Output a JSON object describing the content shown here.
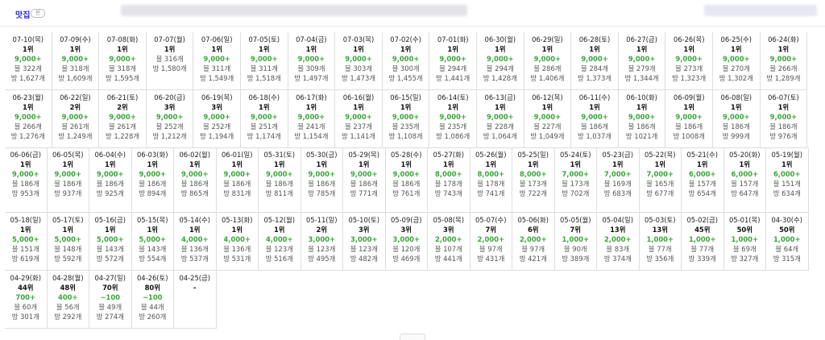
{
  "header": {
    "brand": "맛집",
    "brand_badge": "판"
  },
  "rows": [
    [
      {
        "date": "07-10(목)",
        "rank": "1위",
        "vol": "9,000+",
        "a": "블 322개",
        "b": "방 1,627개"
      },
      {
        "date": "07-09(수)",
        "rank": "1위",
        "vol": "9,000+",
        "a": "블 318개",
        "b": "방 1,609개"
      },
      {
        "date": "07-08(화)",
        "rank": "1위",
        "vol": "9,000+",
        "a": "블 318개",
        "b": "방 1,595개"
      },
      {
        "date": "07-07(월)",
        "rank": "1위",
        "vol": "",
        "a": "블 316개",
        "b": "방 1,580개"
      },
      {
        "date": "07-06(일)",
        "rank": "1위",
        "vol": "9,000+",
        "a": "블 311개",
        "b": "방 1,549개"
      },
      {
        "date": "07-05(토)",
        "rank": "1위",
        "vol": "9,000+",
        "a": "블 311개",
        "b": "방 1,518개"
      },
      {
        "date": "07-04(금)",
        "rank": "1위",
        "vol": "9,000+",
        "a": "블 309개",
        "b": "방 1,497개"
      },
      {
        "date": "07-03(목)",
        "rank": "1위",
        "vol": "9,000+",
        "a": "블 303개",
        "b": "방 1,473개"
      },
      {
        "date": "07-02(수)",
        "rank": "1위",
        "vol": "9,000+",
        "a": "블 300개",
        "b": "방 1,455개"
      },
      {
        "date": "07-01(화)",
        "rank": "1위",
        "vol": "9,000+",
        "a": "블 294개",
        "b": "방 1,441개"
      },
      {
        "date": "06-30(월)",
        "rank": "1위",
        "vol": "9,000+",
        "a": "블 294개",
        "b": "방 1,428개"
      },
      {
        "date": "06-29(일)",
        "rank": "1위",
        "vol": "9,000+",
        "a": "블 286개",
        "b": "방 1,406개"
      },
      {
        "date": "06-28(토)",
        "rank": "1위",
        "vol": "9,000+",
        "a": "블 284개",
        "b": "방 1,373개"
      },
      {
        "date": "06-27(금)",
        "rank": "1위",
        "vol": "9,000+",
        "a": "블 279개",
        "b": "방 1,344개"
      },
      {
        "date": "06-26(목)",
        "rank": "1위",
        "vol": "9,000+",
        "a": "블 273개",
        "b": "방 1,323개"
      },
      {
        "date": "06-25(수)",
        "rank": "1위",
        "vol": "9,000+",
        "a": "블 270개",
        "b": "방 1,302개"
      },
      {
        "date": "06-24(화)",
        "rank": "1위",
        "vol": "9,000+",
        "a": "블 266개",
        "b": "방 1,289개"
      }
    ],
    [
      {
        "date": "06-23(월)",
        "rank": "1위",
        "vol": "9,000+",
        "a": "블 266개",
        "b": "방 1,276개"
      },
      {
        "date": "06-22(일)",
        "rank": "2위",
        "vol": "9,000+",
        "a": "블 261개",
        "b": "방 1,249개"
      },
      {
        "date": "06-21(토)",
        "rank": "2위",
        "vol": "9,000+",
        "a": "블 261개",
        "b": "방 1,228개"
      },
      {
        "date": "06-20(금)",
        "rank": "3위",
        "vol": "9,000+",
        "a": "블 252개",
        "b": "방 1,212개"
      },
      {
        "date": "06-19(목)",
        "rank": "3위",
        "vol": "9,000+",
        "a": "블 252개",
        "b": "방 1,194개"
      },
      {
        "date": "06-18(수)",
        "rank": "1위",
        "vol": "9,000+",
        "a": "블 251개",
        "b": "방 1,174개"
      },
      {
        "date": "06-17(화)",
        "rank": "1위",
        "vol": "9,000+",
        "a": "블 241개",
        "b": "방 1,154개"
      },
      {
        "date": "06-16(월)",
        "rank": "1위",
        "vol": "9,000+",
        "a": "블 237개",
        "b": "방 1,141개"
      },
      {
        "date": "06-15(일)",
        "rank": "1위",
        "vol": "9,000+",
        "a": "블 235개",
        "b": "방 1,108개"
      },
      {
        "date": "06-14(토)",
        "rank": "1위",
        "vol": "9,000+",
        "a": "블 235개",
        "b": "방 1,086개"
      },
      {
        "date": "06-13(금)",
        "rank": "1위",
        "vol": "9,000+",
        "a": "블 228개",
        "b": "방 1,064개"
      },
      {
        "date": "06-12(목)",
        "rank": "1위",
        "vol": "9,000+",
        "a": "블 227개",
        "b": "방 1,049개"
      },
      {
        "date": "06-11(수)",
        "rank": "1위",
        "vol": "9,000+",
        "a": "블 186개",
        "b": "방 1,037개"
      },
      {
        "date": "06-10(화)",
        "rank": "1위",
        "vol": "9,000+",
        "a": "블 186개",
        "b": "방 1021개"
      },
      {
        "date": "06-09(월)",
        "rank": "1위",
        "vol": "9,000+",
        "a": "블 186개",
        "b": "방 1008개"
      },
      {
        "date": "06-08(일)",
        "rank": "1위",
        "vol": "9,000+",
        "a": "블 186개",
        "b": "방 999개"
      },
      {
        "date": "06-07(토)",
        "rank": "1위",
        "vol": "9,000+",
        "a": "블 186개",
        "b": "방 976개"
      }
    ],
    [
      {
        "date": "06-06(금)",
        "rank": "1위",
        "vol": "9,000+",
        "a": "블 186개",
        "b": "방 953개"
      },
      {
        "date": "06-05(목)",
        "rank": "1위",
        "vol": "9,000+",
        "a": "블 186개",
        "b": "방 937개"
      },
      {
        "date": "06-04(수)",
        "rank": "1위",
        "vol": "9,000+",
        "a": "블 186개",
        "b": "방 925개"
      },
      {
        "date": "06-03(화)",
        "rank": "1위",
        "vol": "9,000+",
        "a": "블 186개",
        "b": "방 894개"
      },
      {
        "date": "06-02(월)",
        "rank": "1위",
        "vol": "9,000+",
        "a": "블 186개",
        "b": "방 865개"
      },
      {
        "date": "06-01(일)",
        "rank": "1위",
        "vol": "9,000+",
        "a": "블 186개",
        "b": "방 831개"
      },
      {
        "date": "05-31(토)",
        "rank": "1위",
        "vol": "9,000+",
        "a": "블 186개",
        "b": "방 811개"
      },
      {
        "date": "05-30(금)",
        "rank": "1위",
        "vol": "9,000+",
        "a": "블 186개",
        "b": "방 785개"
      },
      {
        "date": "05-29(목)",
        "rank": "1위",
        "vol": "9,000+",
        "a": "블 186개",
        "b": "방 771개"
      },
      {
        "date": "05-28(수)",
        "rank": "1위",
        "vol": "9,000+",
        "a": "블 186개",
        "b": "방 761개"
      },
      {
        "date": "05-27(화)",
        "rank": "1위",
        "vol": "8,000+",
        "a": "블 178개",
        "b": "방 743개"
      },
      {
        "date": "05-26(월)",
        "rank": "1위",
        "vol": "8,000+",
        "a": "블 178개",
        "b": "방 741개"
      },
      {
        "date": "05-25(일)",
        "rank": "1위",
        "vol": "8,000+",
        "a": "블 173개",
        "b": "방 722개"
      },
      {
        "date": "05-24(토)",
        "rank": "1위",
        "vol": "7,000+",
        "a": "블 173개",
        "b": "방 702개"
      },
      {
        "date": "05-23(금)",
        "rank": "1위",
        "vol": "7,000+",
        "a": "블 169개",
        "b": "방 683개"
      },
      {
        "date": "05-22(목)",
        "rank": "1위",
        "vol": "7,000+",
        "a": "블 165개",
        "b": "방 677개"
      },
      {
        "date": "05-21(수)",
        "rank": "1위",
        "vol": "6,000+",
        "a": "블 157개",
        "b": "방 654개"
      },
      {
        "date": "05-20(화)",
        "rank": "1위",
        "vol": "6,000+",
        "a": "블 157개",
        "b": "방 647개"
      },
      {
        "date": "05-19(월)",
        "rank": "1위",
        "vol": "6,000+",
        "a": "블 151개",
        "b": "방 634개"
      }
    ],
    [
      {
        "date": "05-18(일)",
        "rank": "1위",
        "vol": "5,000+",
        "a": "블 151개",
        "b": "방 619개"
      },
      {
        "date": "05-17(토)",
        "rank": "1위",
        "vol": "5,000+",
        "a": "블 148개",
        "b": "방 592개"
      },
      {
        "date": "05-16(금)",
        "rank": "1위",
        "vol": "5,000+",
        "a": "블 143개",
        "b": "방 572개"
      },
      {
        "date": "05-15(목)",
        "rank": "1위",
        "vol": "5,000+",
        "a": "블 143개",
        "b": "방 554개"
      },
      {
        "date": "05-14(수)",
        "rank": "1위",
        "vol": "4,000+",
        "a": "블 136개",
        "b": "방 537개"
      },
      {
        "date": "05-13(화)",
        "rank": "1위",
        "vol": "4,000+",
        "a": "블 136개",
        "b": "방 531개"
      },
      {
        "date": "05-12(월)",
        "rank": "1위",
        "vol": "4,000+",
        "a": "블 123개",
        "b": "방 516개"
      },
      {
        "date": "05-11(일)",
        "rank": "2위",
        "vol": "3,000+",
        "a": "블 123개",
        "b": "방 495개"
      },
      {
        "date": "05-10(토)",
        "rank": "3위",
        "vol": "3,000+",
        "a": "블 123개",
        "b": "방 482개"
      },
      {
        "date": "05-09(금)",
        "rank": "3위",
        "vol": "3,000+",
        "a": "블 120개",
        "b": "방 469개"
      },
      {
        "date": "05-08(목)",
        "rank": "3위",
        "vol": "2,000+",
        "a": "블 107개",
        "b": "방 441개"
      },
      {
        "date": "05-07(수)",
        "rank": "7위",
        "vol": "2,000+",
        "a": "블 97개",
        "b": "방 431개"
      },
      {
        "date": "05-06(화)",
        "rank": "6위",
        "vol": "2,000+",
        "a": "블 97개",
        "b": "방 421개"
      },
      {
        "date": "05-05(월)",
        "rank": "7위",
        "vol": "1,000+",
        "a": "블 90개",
        "b": "방 389개"
      },
      {
        "date": "05-04(일)",
        "rank": "13위",
        "vol": "2,000+",
        "a": "블 83개",
        "b": "방 374개"
      },
      {
        "date": "05-03(토)",
        "rank": "13위",
        "vol": "1,000+",
        "a": "블 77개",
        "b": "방 356개"
      },
      {
        "date": "05-02(금)",
        "rank": "45위",
        "vol": "1,000+",
        "a": "블 77개",
        "b": "방 339개"
      },
      {
        "date": "05-01(목)",
        "rank": "50위",
        "vol": "1,000+",
        "a": "블 69개",
        "b": "방 327개"
      },
      {
        "date": "04-30(수)",
        "rank": "50위",
        "vol": "1,000+",
        "a": "블 64개",
        "b": "방 315개"
      }
    ],
    [
      {
        "date": "04-29(화)",
        "rank": "44위",
        "vol": "700+",
        "a": "블 60개",
        "b": "방 301개"
      },
      {
        "date": "04-28(월)",
        "rank": "48위",
        "vol": "400+",
        "a": "블 56개",
        "b": "방 292개"
      },
      {
        "date": "04-27(일)",
        "rank": "70위",
        "vol": "~100",
        "a": "블 49개",
        "b": "방 274개"
      },
      {
        "date": "04-26(토)",
        "rank": "80위",
        "vol": "~100",
        "a": "블 44개",
        "b": "방 260개"
      },
      {
        "date": "04-25(금)",
        "rank": "-",
        "vol": "",
        "a": "",
        "b": ""
      }
    ]
  ]
}
